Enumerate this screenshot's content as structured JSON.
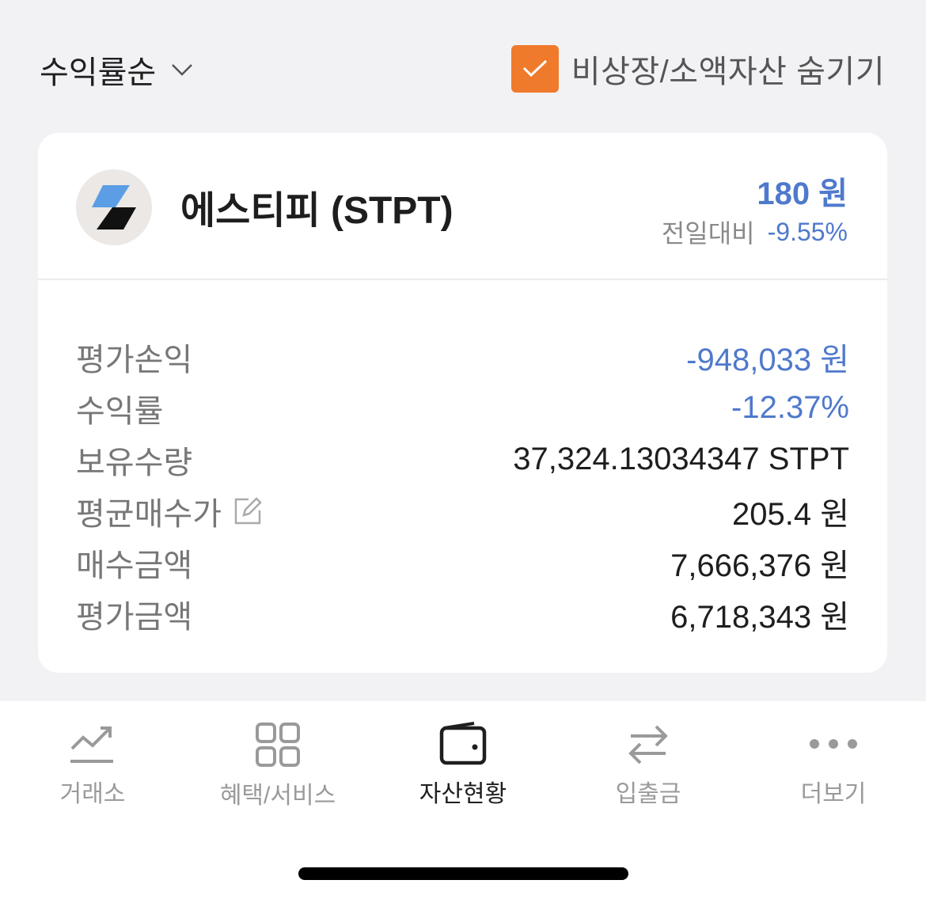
{
  "sort": {
    "label": "수익률순"
  },
  "hide_small": {
    "label": "비상장/소액자산 숨기기",
    "checked": true,
    "color": "#f07a2b"
  },
  "coin": {
    "name": "에스티피 (STPT)",
    "price": "180 원",
    "change_label": "전일대비",
    "change_value": "-9.55%"
  },
  "details": [
    {
      "label": "평가손익",
      "value": "-948,033 원",
      "color": "#4f79cc"
    },
    {
      "label": "수익률",
      "value": "-12.37%",
      "color": "#4f79cc"
    },
    {
      "label": "보유수량",
      "value": "37,324.13034347 STPT"
    },
    {
      "label": "평균매수가",
      "value": "205.4 원",
      "icon": "edit-icon"
    },
    {
      "label": "매수금액",
      "value": "7,666,376 원"
    },
    {
      "label": "평가금액",
      "value": "6,718,343 원"
    }
  ],
  "tabs": [
    {
      "label": "거래소",
      "icon": "chart-trend-icon"
    },
    {
      "label": "혜택/서비스",
      "icon": "grid-icon"
    },
    {
      "label": "자산현황",
      "icon": "wallet-icon",
      "active": true
    },
    {
      "label": "입출금",
      "icon": "transfer-arrows-icon"
    },
    {
      "label": "더보기",
      "icon": "more-dots-icon"
    }
  ]
}
